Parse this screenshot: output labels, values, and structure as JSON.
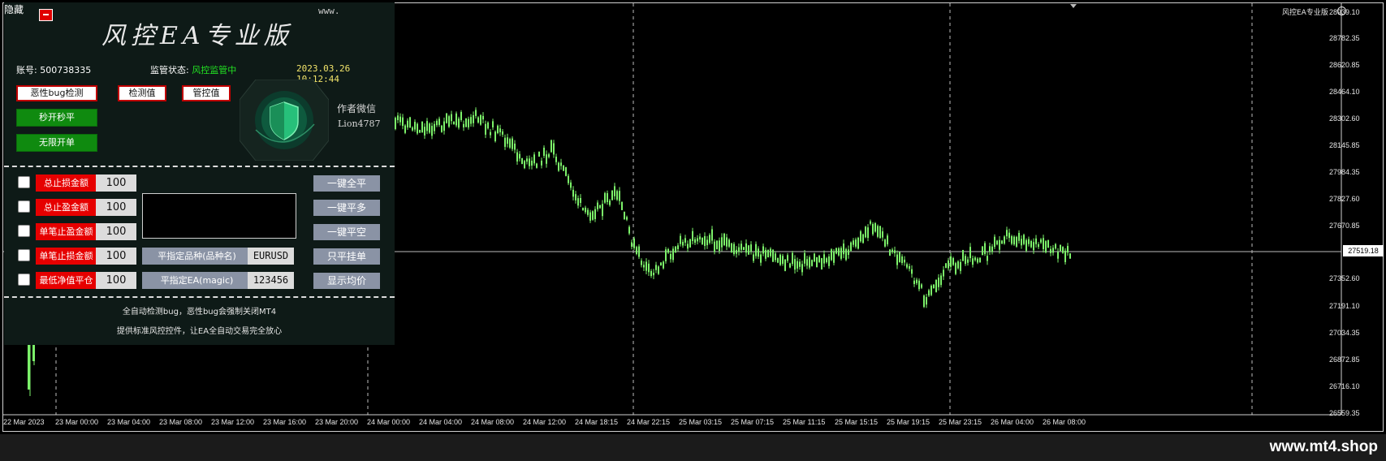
{
  "toggle_label": "隐藏",
  "panel": {
    "url_text": "www.",
    "title": "风控EA专业版",
    "account_label": "账号: 500738335",
    "monitor_label": "监管状态: ",
    "monitor_value": "风控监管中",
    "datetime": "2023.03.26 10:12:44",
    "buttons": {
      "bug_check": "恶性bug检测",
      "check_value": "检测值",
      "control_value": "管控值",
      "instant_close": "秒开秒平",
      "unlimited_open": "无限开单"
    },
    "author_label": "作者微信",
    "author_wechat": "Lion4787",
    "rows": [
      {
        "label": "总止损金额",
        "value": "100",
        "action": "一键全平"
      },
      {
        "label": "总止盈金额",
        "value": "100",
        "action": "一键平多"
      },
      {
        "label": "单笔止盈金额",
        "value": "100",
        "action": "一键平空"
      },
      {
        "label": "单笔止损金额",
        "value": "100",
        "action": "只平挂单"
      },
      {
        "label": "最低净值平仓",
        "value": "100",
        "action": "显示均价"
      }
    ],
    "close_symbol_label": "平指定品种(品种名)",
    "close_symbol_value": "EURUSD",
    "close_ea_label": "平指定EA(magic)",
    "close_ea_value": "123456",
    "footer_line1": "全自动检测bug，恶性bug会强制关闭MT4",
    "footer_line2": "提供标准风控控件，让EA全自动交易完全放心"
  },
  "chart": {
    "ea_label": "风控EA专业版",
    "current_price": "27519.18",
    "price_ticks": [
      "28939.10",
      "28782.35",
      "28620.85",
      "28464.10",
      "28302.60",
      "28145.85",
      "27984.35",
      "27827.60",
      "27670.85",
      "27352.60",
      "27191.10",
      "27034.35",
      "26872.85",
      "26716.10",
      "26559.35"
    ],
    "time_ticks": [
      "22 Mar 2023",
      "23 Mar 00:00",
      "23 Mar 04:00",
      "23 Mar 08:00",
      "23 Mar 12:00",
      "23 Mar 16:00",
      "23 Mar 20:00",
      "24 Mar 00:00",
      "24 Mar 04:00",
      "24 Mar 08:00",
      "24 Mar 12:00",
      "24 Mar 18:15",
      "24 Mar 22:15",
      "25 Mar 03:15",
      "25 Mar 07:15",
      "25 Mar 11:15",
      "25 Mar 15:15",
      "25 Mar 19:15",
      "25 Mar 23:15",
      "26 Mar 04:00",
      "26 Mar 08:00"
    ],
    "candle_color": "#7cf26a"
  },
  "watermark": "www.mt4.shop"
}
